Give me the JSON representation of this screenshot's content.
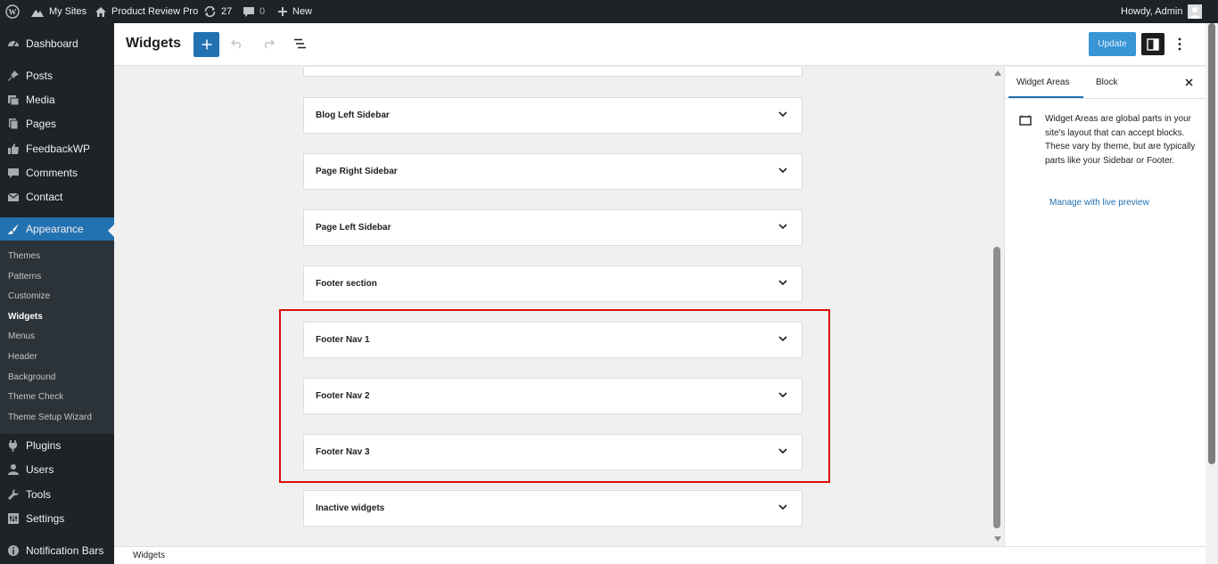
{
  "admin_bar": {
    "my_sites": "My Sites",
    "site_name": "Product Review Pro",
    "updates_count": "27",
    "comments_count": "0",
    "new_label": "New",
    "howdy": "Howdy, Admin"
  },
  "sidebar": {
    "top_items": [
      {
        "label": "Dashboard",
        "icon": "dashboard-icon"
      },
      {
        "label": "Posts",
        "icon": "pushpin-icon"
      },
      {
        "label": "Media",
        "icon": "media-icon"
      },
      {
        "label": "Pages",
        "icon": "pages-icon"
      },
      {
        "label": "FeedbackWP",
        "icon": "thumbs-up-icon"
      },
      {
        "label": "Comments",
        "icon": "comment-icon"
      },
      {
        "label": "Contact",
        "icon": "mail-icon"
      }
    ],
    "active_item": {
      "label": "Appearance",
      "icon": "paintbrush-icon"
    },
    "submenu": [
      "Themes",
      "Patterns",
      "Customize",
      "Widgets",
      "Menus",
      "Header",
      "Background",
      "Theme Check",
      "Theme Setup Wizard"
    ],
    "current_submenu": "Widgets",
    "bottom_items": [
      {
        "label": "Plugins",
        "icon": "plugin-icon"
      },
      {
        "label": "Users",
        "icon": "users-icon"
      },
      {
        "label": "Tools",
        "icon": "wrench-icon"
      },
      {
        "label": "Settings",
        "icon": "settings-icon"
      },
      {
        "label": "Notification Bars",
        "icon": "info-icon"
      }
    ]
  },
  "header": {
    "title": "Widgets",
    "update_label": "Update"
  },
  "widget_areas": [
    {
      "title": "Blog Left Sidebar"
    },
    {
      "title": "Page Right Sidebar"
    },
    {
      "title": "Page Left Sidebar"
    },
    {
      "title": "Footer section"
    },
    {
      "title": "Footer Nav 1"
    },
    {
      "title": "Footer Nav 2"
    },
    {
      "title": "Footer Nav 3"
    },
    {
      "title": "Inactive widgets"
    }
  ],
  "panel": {
    "tab_widget_areas": "Widget Areas",
    "tab_block": "Block",
    "description": "Widget Areas are global parts in your site's layout that can accept blocks. These vary by theme, but are typically parts like your Sidebar or Footer.",
    "link": "Manage with live preview"
  },
  "footer": {
    "breadcrumb": "Widgets"
  },
  "colors": {
    "admin_bar": "#1d2327",
    "accent": "#2271b1",
    "highlight_box": "#d90d0d"
  }
}
